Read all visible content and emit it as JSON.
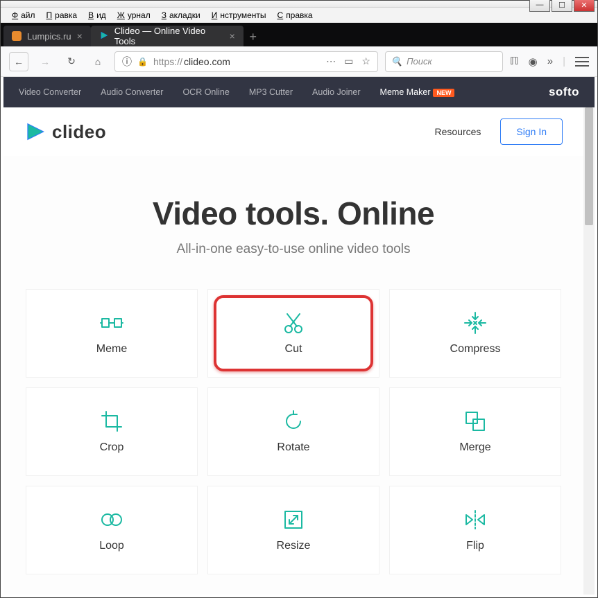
{
  "menubar": [
    "Файл",
    "Правка",
    "Вид",
    "Журнал",
    "Закладки",
    "Инструменты",
    "Справка"
  ],
  "tabs": [
    {
      "title": "Lumpics.ru",
      "active": false
    },
    {
      "title": "Clideo — Online Video Tools",
      "active": true
    }
  ],
  "url": {
    "protocol_prefix": "https://",
    "host": "clideo.com",
    "info_char": "ⓘ"
  },
  "search": {
    "placeholder": "Поиск",
    "glyph": "🔍"
  },
  "softo": {
    "items": [
      "Video Converter",
      "Audio Converter",
      "OCR Online",
      "MP3 Cutter",
      "Audio Joiner"
    ],
    "meme_maker": "Meme Maker",
    "new_badge": "NEW",
    "brand": "softo"
  },
  "site": {
    "brand": "clideo",
    "resources": "Resources",
    "signin": "Sign In"
  },
  "hero": {
    "title": "Video tools. Online",
    "subtitle": "All-in-one easy-to-use online video tools"
  },
  "tools": [
    {
      "label": "Meme",
      "icon": "meme",
      "highlight": false
    },
    {
      "label": "Cut",
      "icon": "cut",
      "highlight": true
    },
    {
      "label": "Compress",
      "icon": "compress",
      "highlight": false
    },
    {
      "label": "Crop",
      "icon": "crop",
      "highlight": false
    },
    {
      "label": "Rotate",
      "icon": "rotate",
      "highlight": false
    },
    {
      "label": "Merge",
      "icon": "merge",
      "highlight": false
    },
    {
      "label": "Loop",
      "icon": "loop",
      "highlight": false
    },
    {
      "label": "Resize",
      "icon": "resize",
      "highlight": false
    },
    {
      "label": "Flip",
      "icon": "flip",
      "highlight": false
    }
  ]
}
